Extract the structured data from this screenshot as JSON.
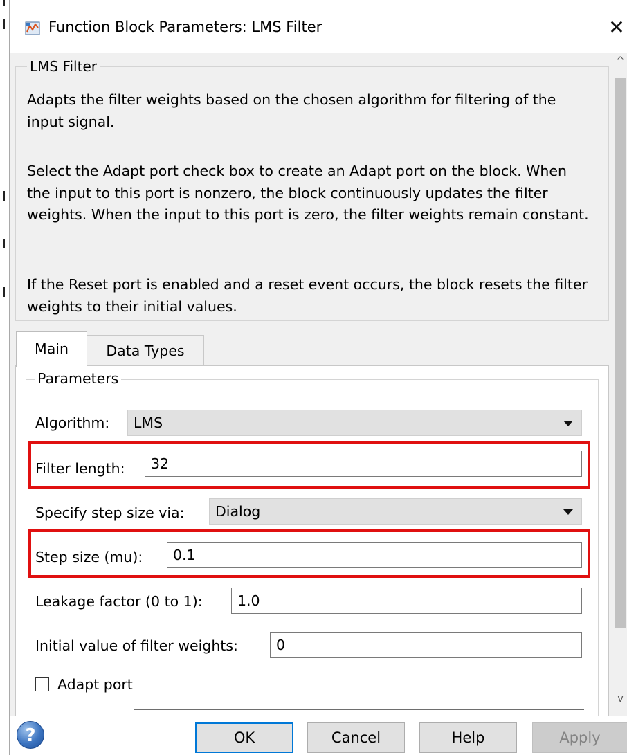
{
  "window": {
    "title": "Function Block Parameters: LMS Filter",
    "title_icon": "simulink-block-icon",
    "close_glyph": "✕"
  },
  "description": {
    "group_title": "LMS Filter",
    "paragraphs": [
      "Adapts the filter weights based on the chosen algorithm for filtering of the input signal.",
      "Select the Adapt port check box to create an Adapt port on the block. When the input to this port is nonzero, the block continuously updates the filter weights. When the input to this port is zero, the filter weights remain constant.",
      "If the Reset port is enabled and a reset event occurs, the block resets the filter weights to their initial values."
    ]
  },
  "tabs": [
    {
      "label": "Main",
      "active": true
    },
    {
      "label": "Data Types",
      "active": false
    }
  ],
  "parameters": {
    "group_title": "Parameters",
    "algorithm": {
      "label": "Algorithm:",
      "value": "LMS"
    },
    "filter_length": {
      "label": "Filter length:",
      "value": "32",
      "highlighted": true
    },
    "step_size_source": {
      "label": "Specify step size via:",
      "value": "Dialog"
    },
    "step_size": {
      "label": "Step size (mu):",
      "value": "0.1",
      "highlighted": true
    },
    "leakage_factor": {
      "label": "Leakage factor (0 to 1):",
      "value": "1.0"
    },
    "initial_weights": {
      "label": "Initial value of filter weights:",
      "value": "0"
    },
    "adapt_port": {
      "label": "Adapt port",
      "checked": false
    }
  },
  "buttons": {
    "help_icon": "?",
    "ok": "OK",
    "cancel": "Cancel",
    "help": "Help",
    "apply": "Apply",
    "apply_enabled": false
  },
  "colors": {
    "highlight_border": "#e01010",
    "ok_focus_border": "#0078d7",
    "panel_background": "#f0f0f0"
  }
}
